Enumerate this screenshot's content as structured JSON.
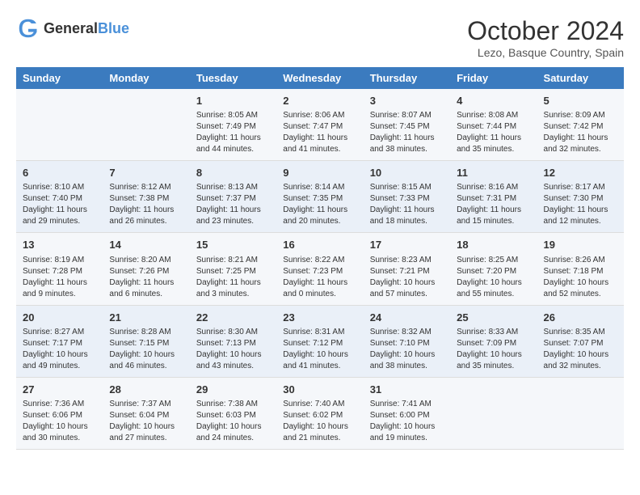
{
  "header": {
    "logo_general": "General",
    "logo_blue": "Blue",
    "month_title": "October 2024",
    "subtitle": "Lezo, Basque Country, Spain"
  },
  "days_of_week": [
    "Sunday",
    "Monday",
    "Tuesday",
    "Wednesday",
    "Thursday",
    "Friday",
    "Saturday"
  ],
  "weeks": [
    [
      {
        "day": "",
        "info": ""
      },
      {
        "day": "",
        "info": ""
      },
      {
        "day": "1",
        "info": "Sunrise: 8:05 AM\nSunset: 7:49 PM\nDaylight: 11 hours and 44 minutes."
      },
      {
        "day": "2",
        "info": "Sunrise: 8:06 AM\nSunset: 7:47 PM\nDaylight: 11 hours and 41 minutes."
      },
      {
        "day": "3",
        "info": "Sunrise: 8:07 AM\nSunset: 7:45 PM\nDaylight: 11 hours and 38 minutes."
      },
      {
        "day": "4",
        "info": "Sunrise: 8:08 AM\nSunset: 7:44 PM\nDaylight: 11 hours and 35 minutes."
      },
      {
        "day": "5",
        "info": "Sunrise: 8:09 AM\nSunset: 7:42 PM\nDaylight: 11 hours and 32 minutes."
      }
    ],
    [
      {
        "day": "6",
        "info": "Sunrise: 8:10 AM\nSunset: 7:40 PM\nDaylight: 11 hours and 29 minutes."
      },
      {
        "day": "7",
        "info": "Sunrise: 8:12 AM\nSunset: 7:38 PM\nDaylight: 11 hours and 26 minutes."
      },
      {
        "day": "8",
        "info": "Sunrise: 8:13 AM\nSunset: 7:37 PM\nDaylight: 11 hours and 23 minutes."
      },
      {
        "day": "9",
        "info": "Sunrise: 8:14 AM\nSunset: 7:35 PM\nDaylight: 11 hours and 20 minutes."
      },
      {
        "day": "10",
        "info": "Sunrise: 8:15 AM\nSunset: 7:33 PM\nDaylight: 11 hours and 18 minutes."
      },
      {
        "day": "11",
        "info": "Sunrise: 8:16 AM\nSunset: 7:31 PM\nDaylight: 11 hours and 15 minutes."
      },
      {
        "day": "12",
        "info": "Sunrise: 8:17 AM\nSunset: 7:30 PM\nDaylight: 11 hours and 12 minutes."
      }
    ],
    [
      {
        "day": "13",
        "info": "Sunrise: 8:19 AM\nSunset: 7:28 PM\nDaylight: 11 hours and 9 minutes."
      },
      {
        "day": "14",
        "info": "Sunrise: 8:20 AM\nSunset: 7:26 PM\nDaylight: 11 hours and 6 minutes."
      },
      {
        "day": "15",
        "info": "Sunrise: 8:21 AM\nSunset: 7:25 PM\nDaylight: 11 hours and 3 minutes."
      },
      {
        "day": "16",
        "info": "Sunrise: 8:22 AM\nSunset: 7:23 PM\nDaylight: 11 hours and 0 minutes."
      },
      {
        "day": "17",
        "info": "Sunrise: 8:23 AM\nSunset: 7:21 PM\nDaylight: 10 hours and 57 minutes."
      },
      {
        "day": "18",
        "info": "Sunrise: 8:25 AM\nSunset: 7:20 PM\nDaylight: 10 hours and 55 minutes."
      },
      {
        "day": "19",
        "info": "Sunrise: 8:26 AM\nSunset: 7:18 PM\nDaylight: 10 hours and 52 minutes."
      }
    ],
    [
      {
        "day": "20",
        "info": "Sunrise: 8:27 AM\nSunset: 7:17 PM\nDaylight: 10 hours and 49 minutes."
      },
      {
        "day": "21",
        "info": "Sunrise: 8:28 AM\nSunset: 7:15 PM\nDaylight: 10 hours and 46 minutes."
      },
      {
        "day": "22",
        "info": "Sunrise: 8:30 AM\nSunset: 7:13 PM\nDaylight: 10 hours and 43 minutes."
      },
      {
        "day": "23",
        "info": "Sunrise: 8:31 AM\nSunset: 7:12 PM\nDaylight: 10 hours and 41 minutes."
      },
      {
        "day": "24",
        "info": "Sunrise: 8:32 AM\nSunset: 7:10 PM\nDaylight: 10 hours and 38 minutes."
      },
      {
        "day": "25",
        "info": "Sunrise: 8:33 AM\nSunset: 7:09 PM\nDaylight: 10 hours and 35 minutes."
      },
      {
        "day": "26",
        "info": "Sunrise: 8:35 AM\nSunset: 7:07 PM\nDaylight: 10 hours and 32 minutes."
      }
    ],
    [
      {
        "day": "27",
        "info": "Sunrise: 7:36 AM\nSunset: 6:06 PM\nDaylight: 10 hours and 30 minutes."
      },
      {
        "day": "28",
        "info": "Sunrise: 7:37 AM\nSunset: 6:04 PM\nDaylight: 10 hours and 27 minutes."
      },
      {
        "day": "29",
        "info": "Sunrise: 7:38 AM\nSunset: 6:03 PM\nDaylight: 10 hours and 24 minutes."
      },
      {
        "day": "30",
        "info": "Sunrise: 7:40 AM\nSunset: 6:02 PM\nDaylight: 10 hours and 21 minutes."
      },
      {
        "day": "31",
        "info": "Sunrise: 7:41 AM\nSunset: 6:00 PM\nDaylight: 10 hours and 19 minutes."
      },
      {
        "day": "",
        "info": ""
      },
      {
        "day": "",
        "info": ""
      }
    ]
  ]
}
